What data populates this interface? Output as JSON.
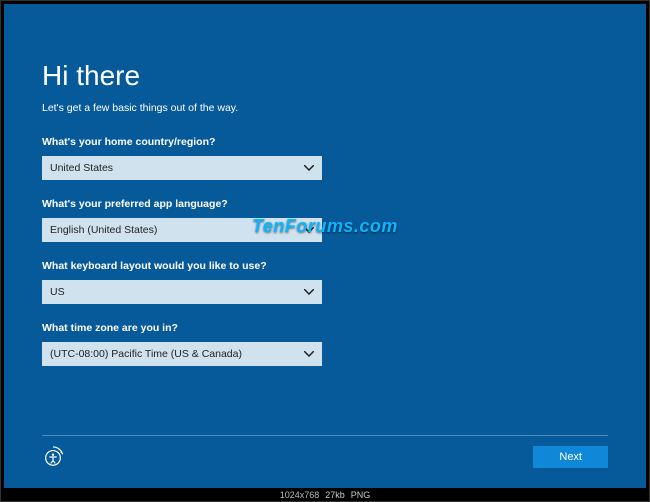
{
  "heading": "Hi there",
  "subtitle": "Let's get a few basic things out of the way.",
  "fields": {
    "country": {
      "label": "What's your home country/region?",
      "value": "United States"
    },
    "language": {
      "label": "What's your preferred app language?",
      "value": "English (United States)"
    },
    "keyboard": {
      "label": "What keyboard layout would you like to use?",
      "value": "US"
    },
    "timezone": {
      "label": "What time zone are you in?",
      "value": "(UTC-08:00) Pacific Time (US & Canada)"
    }
  },
  "watermark": "TenForums.com",
  "buttons": {
    "next": "Next"
  },
  "status": {
    "dimensions": "1024x768",
    "size": "27kb",
    "type": "PNG"
  }
}
